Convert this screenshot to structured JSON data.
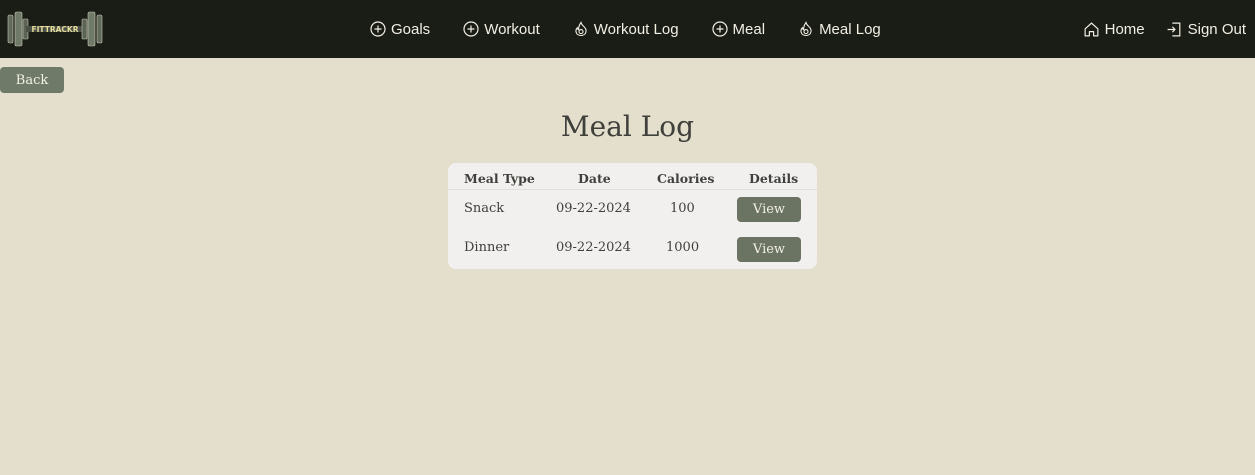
{
  "brand": {
    "logo_text": "FITTRACKR"
  },
  "nav": {
    "center": [
      {
        "label": "Goals",
        "icon": "plus-circle-icon"
      },
      {
        "label": "Workout",
        "icon": "plus-circle-icon"
      },
      {
        "label": "Workout Log",
        "icon": "fire-icon"
      },
      {
        "label": "Meal",
        "icon": "plus-circle-icon"
      },
      {
        "label": "Meal Log",
        "icon": "fire-icon"
      }
    ],
    "right": [
      {
        "label": "Home",
        "icon": "home-icon"
      },
      {
        "label": "Sign Out",
        "icon": "sign-out-icon"
      }
    ]
  },
  "back_label": "Back",
  "page_title": "Meal Log",
  "table": {
    "headers": [
      "Meal Type",
      "Date",
      "Calories",
      "Details"
    ],
    "rows": [
      {
        "meal_type": "Snack",
        "date": "09-22-2024",
        "calories": "100",
        "action": "View"
      },
      {
        "meal_type": "Dinner",
        "date": "09-22-2024",
        "calories": "1000",
        "action": "View"
      }
    ]
  },
  "colors": {
    "navbar_bg": "#1a1c16",
    "page_bg": "#e4dfcc",
    "button_bg": "#6b7463",
    "card_bg": "#f1f0ef"
  }
}
